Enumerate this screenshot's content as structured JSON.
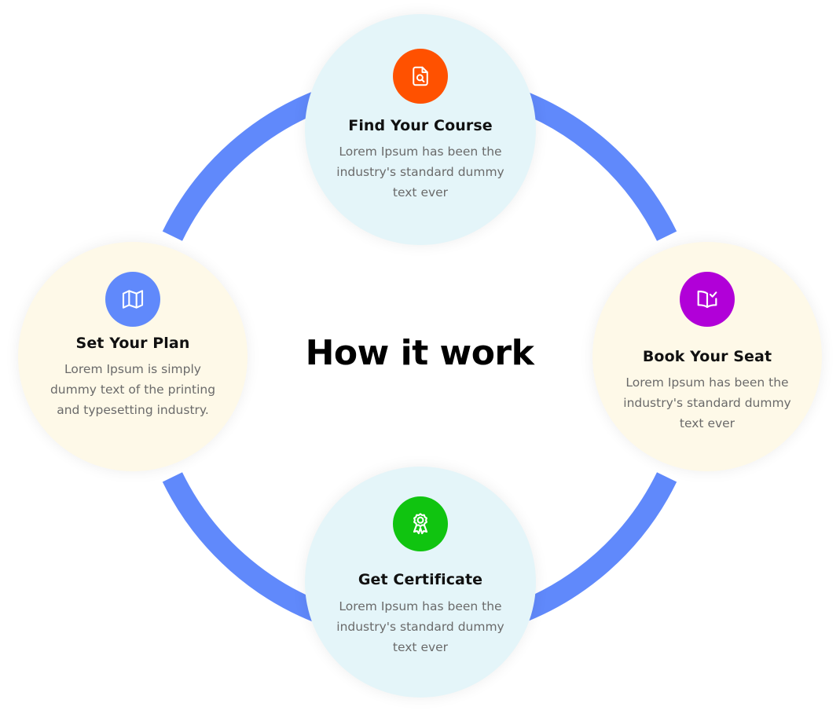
{
  "title": "How it work",
  "colors": {
    "ring": "#6089fb",
    "blue_bubble": "#e4f5f9",
    "cream_bubble": "#fef9e8"
  },
  "steps": {
    "find": {
      "title": "Find Your Course",
      "description": "Lorem Ipsum has been the industry's standard dummy text ever",
      "icon": "document-search-icon",
      "badge_color": "#ff5100"
    },
    "plan": {
      "title": "Set Your Plan",
      "description": "Lorem Ipsum is simply dummy text of the printing and typesetting industry.",
      "icon": "map-icon",
      "badge_color": "#6089fb"
    },
    "book": {
      "title": "Book Your Seat",
      "description": "Lorem Ipsum has been the industry's standard dummy text ever",
      "icon": "book-check-icon",
      "badge_color": "#b100d8"
    },
    "cert": {
      "title": "Get Certificate",
      "description": "Lorem Ipsum has been the industry's standard dummy text ever",
      "icon": "award-ribbon-icon",
      "badge_color": "#10c410"
    }
  }
}
